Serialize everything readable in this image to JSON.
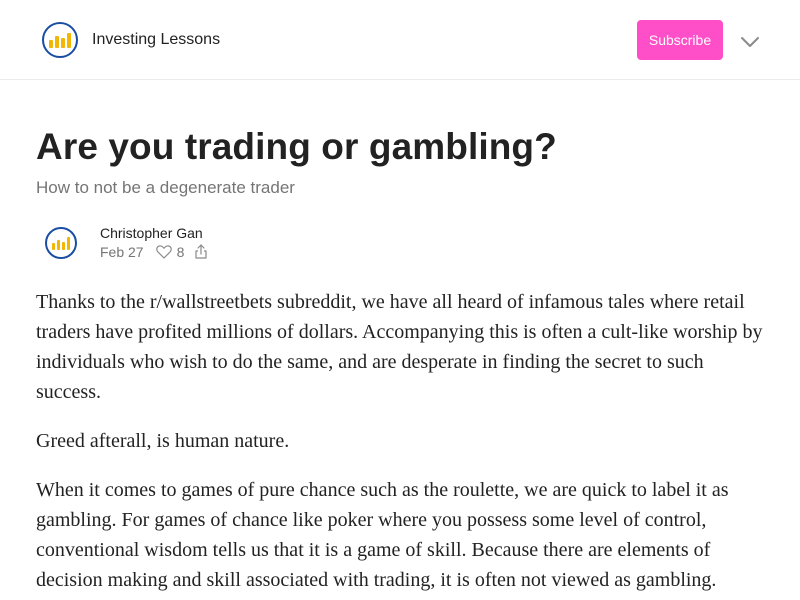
{
  "header": {
    "publication_name": "Investing Lessons",
    "subscribe_label": "Subscribe",
    "menu_icon": "chevron-down-icon",
    "logo_icon": "bar-chart-logo"
  },
  "post": {
    "title": "Are you trading or gambling?",
    "subtitle": "How to not be a degenerate trader",
    "author": "Christopher Gan",
    "date": "Feb 27",
    "like_count": "8",
    "like_icon": "heart-icon",
    "share_icon": "share-icon",
    "paragraphs": [
      "Thanks to the r/wallstreetbets subreddit, we have all heard of infamous tales where retail traders have profited millions of dollars. Accompanying this is often a cult-like worship by individuals who wish to do the same, and are desperate in finding the secret to such success.",
      "Greed afterall, is human nature.",
      "When it comes to games of pure chance such as the roulette, we are quick to label it as gambling. For games of chance like poker where you possess some level of control, conventional wisdom tells us that it is a game of skill. Because there are elements of decision making and skill associated with trading, it is often not viewed as gambling."
    ]
  },
  "colors": {
    "accent": "#ff4fc8",
    "logo_ring": "#1a4ea3",
    "logo_bars": "#f2b705",
    "muted_text": "#757575"
  }
}
